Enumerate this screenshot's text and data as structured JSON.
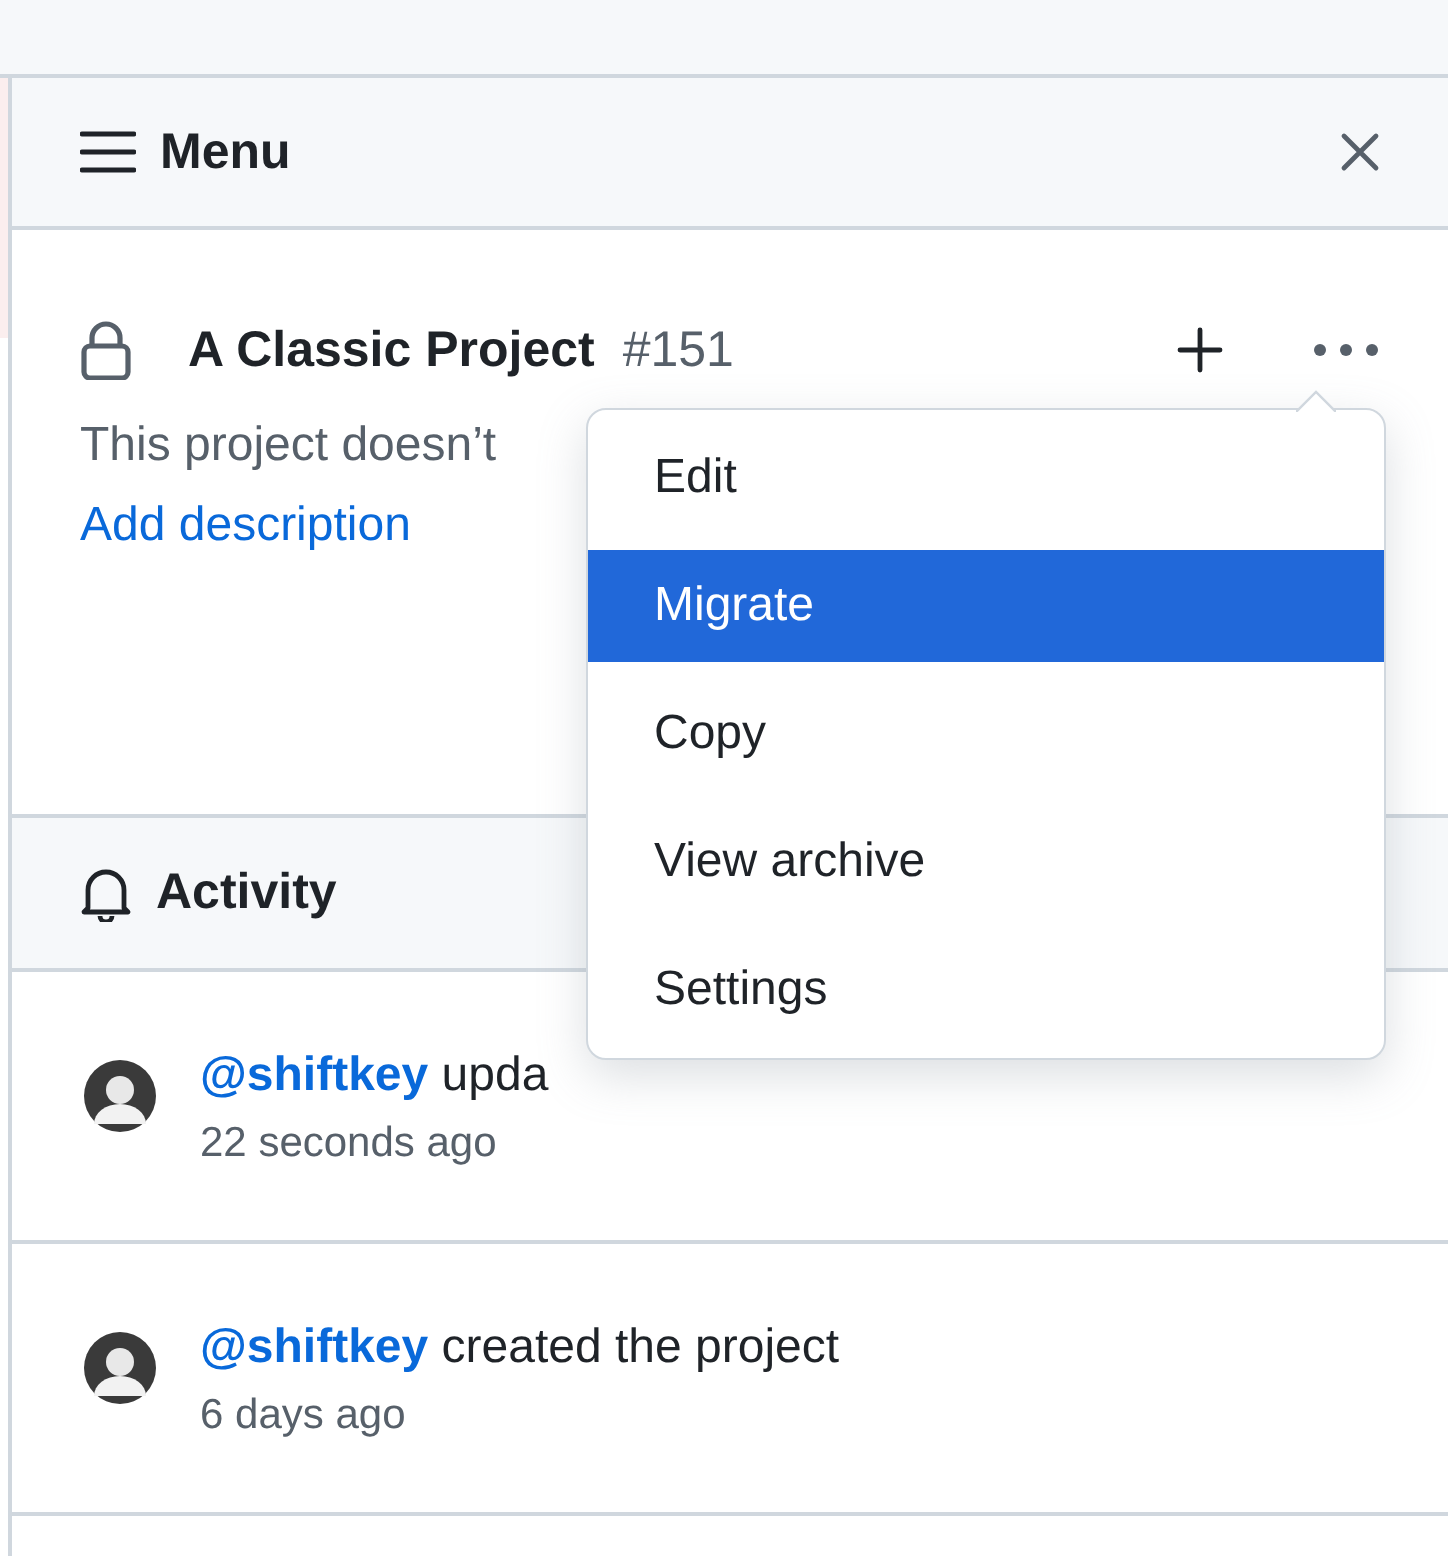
{
  "panel": {
    "title": "Menu"
  },
  "project": {
    "title": "A Classic Project",
    "number": "#151",
    "description": "This project doesn’t",
    "add_description": "Add description"
  },
  "menu": {
    "items": [
      {
        "label": "Edit",
        "selected": false
      },
      {
        "label": "Migrate",
        "selected": true
      },
      {
        "label": "Copy",
        "selected": false
      },
      {
        "label": "View archive",
        "selected": false
      },
      {
        "label": "Settings",
        "selected": false
      }
    ]
  },
  "activity": {
    "title": "Activity",
    "events": [
      {
        "user": "@shiftkey",
        "action": "upda",
        "time": "22 seconds ago"
      },
      {
        "user": "@shiftkey",
        "action": "created the project",
        "time": "6 days ago"
      }
    ]
  }
}
